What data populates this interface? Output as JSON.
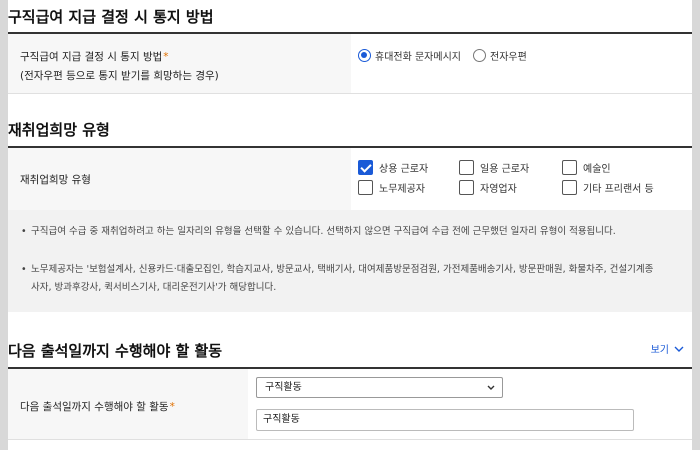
{
  "notify_section": {
    "title": "구직급여 지급 결정 시 통지 방법",
    "label": "구직급여 지급 결정 시 통지 방법",
    "required_mark": "*",
    "note": "(전자우편 등으로 통지 받기를 희망하는 경우)",
    "options": [
      {
        "label": "휴대전화 문자메시지",
        "selected": true
      },
      {
        "label": "전자우편",
        "selected": false
      }
    ]
  },
  "reemployment_section": {
    "title": "재취업희망 유형",
    "label": "재취업희망 유형",
    "checkboxes": [
      {
        "label": "상용 근로자",
        "checked": true
      },
      {
        "label": "일용 근로자",
        "checked": false
      },
      {
        "label": "예술인",
        "checked": false
      },
      {
        "label": "노무제공자",
        "checked": false
      },
      {
        "label": "자영업자",
        "checked": false
      },
      {
        "label": "기타 프리랜서 등",
        "checked": false
      }
    ],
    "info": [
      "구직급여 수급 중 재취업하려고 하는 일자리의 유형을 선택할 수 있습니다. 선택하지 않으면 구직급여 수급 전에 근무했던 일자리 유형이 적용됩니다.",
      "노무제공자는 '보험설계사, 신용카드·대출모집인, 학습지교사, 방문교사, 택배기사, 대여제품방문점검원, 가전제품배송기사, 방문판매원, 화물차주, 건설기계종사자, 방과후강사, 퀵서비스기사, 대리운전기사'가 해당합니다."
    ]
  },
  "activity_section": {
    "title": "다음 출석일까지 수행해야 할 활동",
    "view_label": "보기",
    "label": "다음 출석일까지 수행해야 할 활동",
    "required_mark": "*",
    "select_value": "구직활동",
    "input_value": "구직활동"
  },
  "colors": {
    "accent": "#1a5ad7",
    "required": "#e07000",
    "label_bg": "#f7f7f7",
    "info_bg": "#f2f2f2"
  }
}
